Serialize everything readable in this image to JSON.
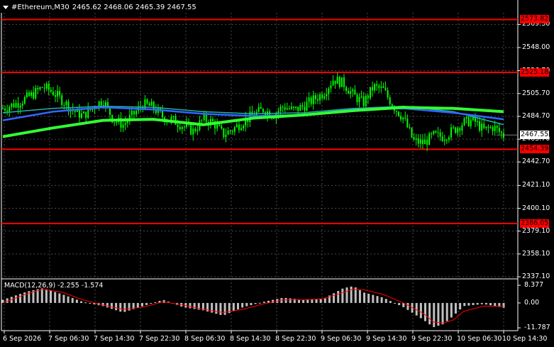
{
  "header": {
    "symbol": "#Ethereum,M30",
    "ohlc": "2465.62 2468.06 2465.39 2467.55"
  },
  "price_axis": {
    "labels": [
      "2569.30",
      "2548.00",
      "2526.70",
      "2505.70",
      "2484.70",
      "2463.70",
      "2442.70",
      "2421.10",
      "2400.10",
      "2379.10",
      "2358.10",
      "2337.10"
    ],
    "current_price": "2467.55",
    "levels": [
      "2573.82",
      "2525.18",
      "2454.39",
      "2386.05"
    ]
  },
  "macd": {
    "label": "MACD(12,26,9) -2.255 -1.574",
    "axis_labels": [
      "8.377",
      "0.00",
      "-11.787"
    ]
  },
  "time_axis": {
    "labels": [
      "6 Sep 2026",
      "7 Sep 06:30",
      "7 Sep 14:30",
      "7 Sep 22:30",
      "8 Sep 06:30",
      "8 Sep 14:30",
      "8 Sep 22:30",
      "9 Sep 06:30",
      "9 Sep 14:30",
      "9 Sep 22:30",
      "10 Sep 06:30",
      "10 Sep 14:30"
    ]
  },
  "colors": {
    "background": "#000000",
    "candles": "#00ff00",
    "level_lines": "#ff0000",
    "ma_fast": "#33ff33",
    "ma_mid": "#3366ff",
    "ma_slow": "#20b2aa",
    "macd_hist": "#c0c0c0",
    "macd_signal": "#ff0000"
  },
  "chart_data": {
    "type": "candlestick",
    "symbol": "#Ethereum",
    "timeframe": "M30",
    "y_range": [
      2337.1,
      2580
    ],
    "horizontal_levels": [
      2573.82,
      2525.18,
      2454.39,
      2386.05
    ],
    "last_price": 2467.55,
    "close_path": [
      [
        0,
        2492
      ],
      [
        3,
        2497
      ],
      [
        6,
        2505
      ],
      [
        8,
        2512
      ],
      [
        10,
        2507
      ],
      [
        12,
        2499
      ],
      [
        14,
        2490
      ],
      [
        16,
        2485
      ],
      [
        18,
        2493
      ],
      [
        20,
        2500
      ],
      [
        22,
        2482
      ],
      [
        24,
        2477
      ],
      [
        26,
        2486
      ],
      [
        28,
        2496
      ],
      [
        30,
        2493
      ],
      [
        32,
        2484
      ],
      [
        34,
        2481
      ],
      [
        36,
        2476
      ],
      [
        38,
        2471
      ],
      [
        40,
        2482
      ],
      [
        42,
        2479
      ],
      [
        44,
        2468
      ],
      [
        46,
        2473
      ],
      [
        48,
        2480
      ],
      [
        50,
        2486
      ],
      [
        52,
        2491
      ],
      [
        54,
        2486
      ],
      [
        56,
        2494
      ],
      [
        58,
        2490
      ],
      [
        60,
        2494
      ],
      [
        62,
        2500
      ],
      [
        64,
        2506
      ],
      [
        66,
        2519
      ],
      [
        68,
        2515
      ],
      [
        70,
        2504
      ],
      [
        72,
        2497
      ],
      [
        74,
        2512
      ],
      [
        76,
        2509
      ],
      [
        78,
        2494
      ],
      [
        80,
        2483
      ],
      [
        82,
        2462
      ],
      [
        84,
        2460
      ],
      [
        86,
        2467
      ],
      [
        88,
        2466
      ],
      [
        90,
        2472
      ],
      [
        92,
        2479
      ],
      [
        94,
        2481
      ],
      [
        96,
        2472
      ],
      [
        98,
        2475
      ],
      [
        100,
        2467
      ]
    ],
    "ma_fast": [
      [
        0,
        2466
      ],
      [
        10,
        2474
      ],
      [
        20,
        2481
      ],
      [
        30,
        2482
      ],
      [
        40,
        2477
      ],
      [
        50,
        2483
      ],
      [
        60,
        2486
      ],
      [
        70,
        2490
      ],
      [
        80,
        2493
      ],
      [
        90,
        2492
      ],
      [
        100,
        2489
      ]
    ],
    "ma_mid": [
      [
        0,
        2481
      ],
      [
        10,
        2489
      ],
      [
        20,
        2493
      ],
      [
        30,
        2491
      ],
      [
        40,
        2487
      ],
      [
        50,
        2485
      ],
      [
        60,
        2486
      ],
      [
        70,
        2491
      ],
      [
        80,
        2492
      ],
      [
        90,
        2488
      ],
      [
        100,
        2482
      ]
    ],
    "ma_slow": [
      [
        0,
        2488
      ],
      [
        10,
        2492
      ],
      [
        20,
        2494
      ],
      [
        30,
        2493
      ],
      [
        40,
        2489
      ],
      [
        50,
        2487
      ],
      [
        60,
        2488
      ],
      [
        70,
        2492
      ],
      [
        80,
        2494
      ],
      [
        90,
        2489
      ],
      [
        100,
        2477
      ]
    ],
    "macd": {
      "y_range": [
        -11.787,
        8.377
      ],
      "histogram": [
        [
          0,
          1.5
        ],
        [
          5,
          5.5
        ],
        [
          8,
          7.0
        ],
        [
          12,
          4.0
        ],
        [
          16,
          0.5
        ],
        [
          20,
          -1.5
        ],
        [
          24,
          -4.5
        ],
        [
          28,
          -1.5
        ],
        [
          32,
          1.5
        ],
        [
          36,
          -2
        ],
        [
          40,
          -3.5
        ],
        [
          44,
          -6
        ],
        [
          48,
          -2
        ],
        [
          52,
          0.5
        ],
        [
          56,
          2.5
        ],
        [
          60,
          1.5
        ],
        [
          64,
          2
        ],
        [
          68,
          7
        ],
        [
          70,
          8.0
        ],
        [
          72,
          5
        ],
        [
          76,
          2.5
        ],
        [
          80,
          -2
        ],
        [
          84,
          -8
        ],
        [
          86,
          -11.5
        ],
        [
          88,
          -10
        ],
        [
          90,
          -6
        ],
        [
          92,
          -1.5
        ],
        [
          96,
          -0.5
        ],
        [
          100,
          -2.25
        ]
      ],
      "signal": [
        [
          0,
          0
        ],
        [
          5,
          4.5
        ],
        [
          8,
          6.5
        ],
        [
          12,
          5.0
        ],
        [
          16,
          1.5
        ],
        [
          20,
          -1
        ],
        [
          24,
          -3
        ],
        [
          28,
          -2
        ],
        [
          32,
          0.5
        ],
        [
          36,
          -1
        ],
        [
          40,
          -3
        ],
        [
          44,
          -4.5
        ],
        [
          48,
          -3
        ],
        [
          52,
          -0.5
        ],
        [
          56,
          1.5
        ],
        [
          60,
          1.5
        ],
        [
          64,
          2
        ],
        [
          68,
          5
        ],
        [
          70,
          6.5
        ],
        [
          72,
          6.3
        ],
        [
          76,
          4
        ],
        [
          80,
          0
        ],
        [
          84,
          -5
        ],
        [
          86,
          -9
        ],
        [
          88,
          -9.5
        ],
        [
          90,
          -8
        ],
        [
          92,
          -4
        ],
        [
          96,
          -1.5
        ],
        [
          100,
          -1.57
        ]
      ]
    }
  }
}
